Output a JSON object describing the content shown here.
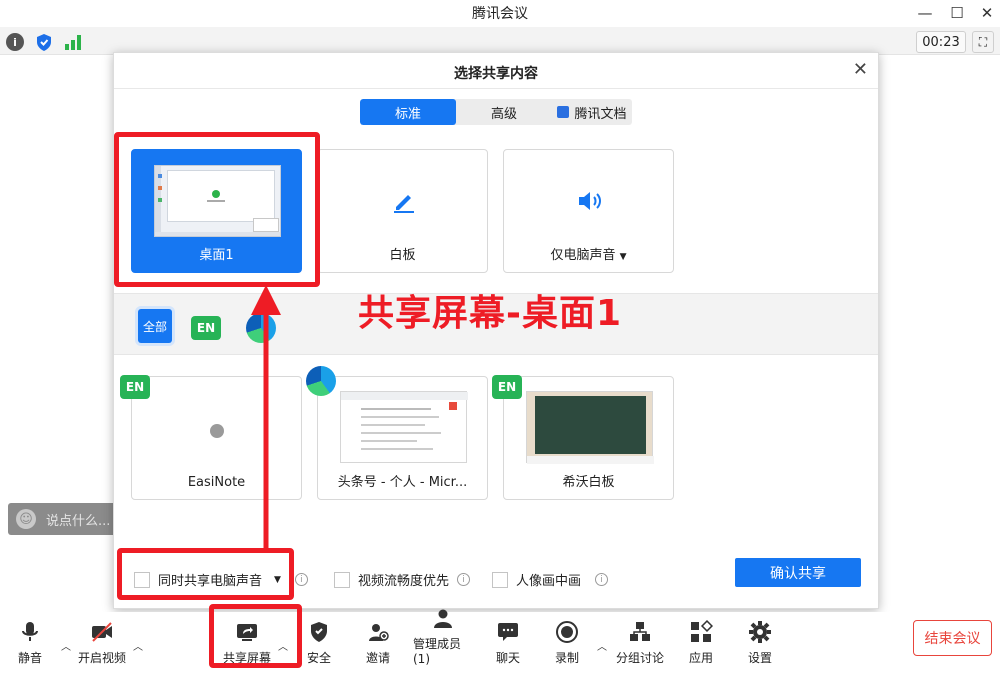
{
  "window": {
    "title": "腾讯会议"
  },
  "status": {
    "timer": "00:23"
  },
  "chat": {
    "placeholder": "说点什么..."
  },
  "dialog": {
    "title": "选择共享内容",
    "tabs": [
      {
        "label": "标准"
      },
      {
        "label": "高级"
      },
      {
        "label": "腾讯文档"
      }
    ],
    "sources": [
      {
        "label": "桌面1"
      },
      {
        "label": "白板"
      },
      {
        "label": "仅电脑声音"
      }
    ],
    "filter": {
      "all_label": "全部",
      "app_badge": "EN"
    },
    "windows": [
      {
        "label": "EasiNote"
      },
      {
        "label": "头条号 - 个人 - Micr..."
      },
      {
        "label": "希沃白板"
      }
    ],
    "options": [
      {
        "label": "同时共享电脑声音"
      },
      {
        "label": "视频流畅度优先"
      },
      {
        "label": "人像画中画"
      }
    ],
    "confirm_label": "确认共享"
  },
  "toolbar": {
    "mute": "静音",
    "video": "开启视频",
    "share": "共享屏幕",
    "security": "安全",
    "invite": "邀请",
    "members": "管理成员(1)",
    "chat": "聊天",
    "record": "录制",
    "breakout": "分组讨论",
    "apps": "应用",
    "settings": "设置",
    "end": "结束会议"
  },
  "annotation": {
    "text": "共享屏幕-桌面1"
  },
  "colors": {
    "accent": "#1677f2",
    "annotation_red": "#ee1c25",
    "end_red": "#e8453c"
  }
}
